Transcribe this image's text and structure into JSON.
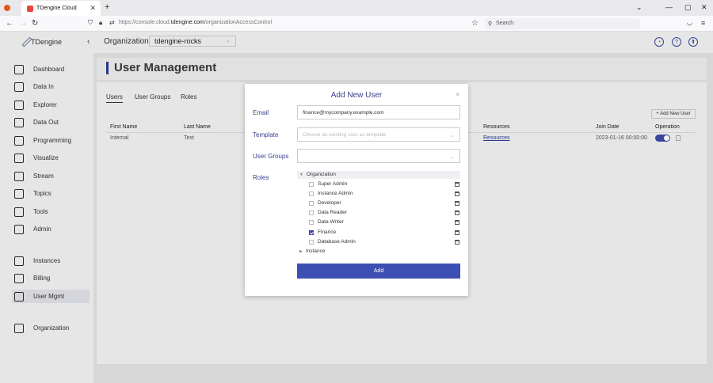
{
  "browser": {
    "tab_title": "TDengine Cloud",
    "url_prefix": "https://console.cloud.",
    "url_domain": "tdengine.com",
    "url_path": "/organizationAccessControl",
    "search_placeholder": "Search"
  },
  "header": {
    "logo_text": "TDengine",
    "org_label": "Organization:",
    "org_value": "tdengine-rocks"
  },
  "sidebar": {
    "items": [
      {
        "label": "Dashboard",
        "icon": "dashboard-icon"
      },
      {
        "label": "Data In",
        "icon": "data-in-icon"
      },
      {
        "label": "Explorer",
        "icon": "explorer-icon"
      },
      {
        "label": "Data Out",
        "icon": "data-out-icon"
      },
      {
        "label": "Programming",
        "icon": "programming-icon"
      },
      {
        "label": "Visualize",
        "icon": "visualize-icon"
      },
      {
        "label": "Stream",
        "icon": "stream-icon"
      },
      {
        "label": "Topics",
        "icon": "topics-icon"
      },
      {
        "label": "Tools",
        "icon": "tools-icon"
      },
      {
        "label": "Admin",
        "icon": "admin-icon"
      },
      {
        "label": "Instances",
        "icon": "instances-icon"
      },
      {
        "label": "Billing",
        "icon": "billing-icon"
      },
      {
        "label": "User Mgmt",
        "icon": "user-mgmt-icon"
      },
      {
        "label": "Organization",
        "icon": "organization-icon"
      }
    ]
  },
  "page": {
    "title": "User Management",
    "tabs": [
      "Users",
      "User Groups",
      "Roles"
    ],
    "add_new_user": "+ Add New User",
    "columns": [
      "First Name",
      "Last Name",
      "Resources",
      "Join Date",
      "Operation"
    ],
    "rows": [
      {
        "first": "Internal",
        "last": "Test",
        "resources": "Resources",
        "join": "2023-01-16 00:00:00"
      }
    ]
  },
  "modal": {
    "title": "Add New User",
    "close": "×",
    "email_label": "Email",
    "email_value": "finance@mycompany.example.com",
    "template_label": "Template",
    "template_placeholder": "Choose an existing user as template",
    "groups_label": "User Groups",
    "roles_label": "Roles",
    "tree_org": "Organization",
    "tree_instance": "Instance",
    "roles": [
      {
        "label": "Super Admin",
        "checked": false
      },
      {
        "label": "Instance Admin",
        "checked": false
      },
      {
        "label": "Developer",
        "checked": false
      },
      {
        "label": "Data Reader",
        "checked": false
      },
      {
        "label": "Data Writer",
        "checked": false
      },
      {
        "label": "Finance",
        "checked": true
      },
      {
        "label": "Database Admin",
        "checked": false
      }
    ],
    "add_button": "Add"
  },
  "colors": {
    "accent": "#3d4fb3",
    "title_blue": "#3a3f8c"
  }
}
